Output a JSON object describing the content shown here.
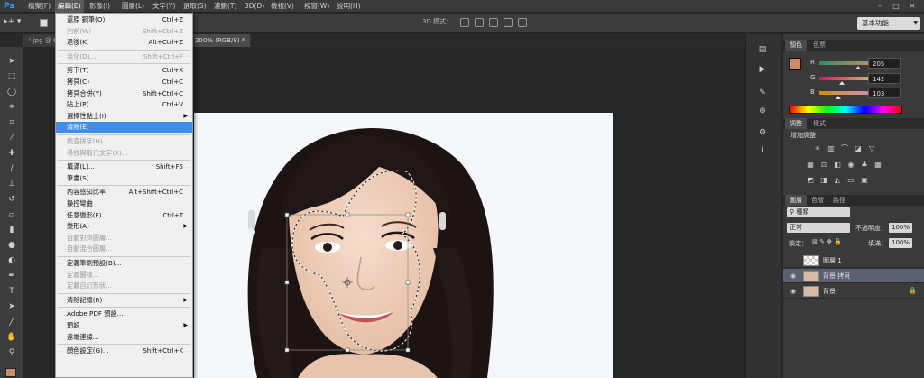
{
  "app": {
    "logo": "Ps"
  },
  "menubar": {
    "items": [
      {
        "label": "檔案(F)"
      },
      {
        "label": "編輯(E)"
      },
      {
        "label": "影像(I)"
      },
      {
        "label": "圖層(L)"
      },
      {
        "label": "文字(Y)"
      },
      {
        "label": "選取(S)"
      },
      {
        "label": "濾鏡(T)"
      },
      {
        "label": "3D(D)"
      },
      {
        "label": "檢視(V)"
      },
      {
        "label": "視窗(W)"
      },
      {
        "label": "說明(H)"
      }
    ],
    "window_controls": [
      "–",
      "□",
      "✕"
    ]
  },
  "options": {
    "mode_3d_label": "3D 模式：",
    "workspace": "基本功能"
  },
  "tabs": [
    {
      "label": "ᵋ.jpg @ 6"
    },
    {
      "label": "ᵋ @ 200% (RGB/8) *"
    }
  ],
  "edit_menu": {
    "items": [
      {
        "label": "還原 鋼筆(O)",
        "shortcut": "Ctrl+Z",
        "disabled": false
      },
      {
        "label": "向前(W)",
        "shortcut": "Shift+Ctrl+Z",
        "disabled": true
      },
      {
        "label": "退後(K)",
        "shortcut": "Alt+Ctrl+Z",
        "disabled": false
      },
      {
        "sep": true
      },
      {
        "label": "淡化(D)...",
        "shortcut": "Shift+Ctrl+F",
        "disabled": true
      },
      {
        "sep": true
      },
      {
        "label": "剪下(T)",
        "shortcut": "Ctrl+X",
        "disabled": false
      },
      {
        "label": "拷貝(C)",
        "shortcut": "Ctrl+C",
        "disabled": false
      },
      {
        "label": "拷貝合併(Y)",
        "shortcut": "Shift+Ctrl+C",
        "disabled": false
      },
      {
        "label": "貼上(P)",
        "shortcut": "Ctrl+V",
        "disabled": false
      },
      {
        "label": "選擇性貼上(I)",
        "shortcut": "",
        "submenu": true,
        "disabled": false
      },
      {
        "label": "清除(E)",
        "shortcut": "",
        "disabled": false,
        "highlight": true
      },
      {
        "sep": true
      },
      {
        "label": "檢查拼字(H)...",
        "shortcut": "",
        "disabled": true
      },
      {
        "label": "尋找與取代文字(X)...",
        "shortcut": "",
        "disabled": true
      },
      {
        "sep": true
      },
      {
        "label": "填滿(L)...",
        "shortcut": "Shift+F5",
        "disabled": false
      },
      {
        "label": "筆畫(S)...",
        "shortcut": "",
        "disabled": false
      },
      {
        "sep": true
      },
      {
        "label": "內容感知比率",
        "shortcut": "Alt+Shift+Ctrl+C",
        "disabled": false
      },
      {
        "label": "操控彎曲",
        "shortcut": "",
        "disabled": false
      },
      {
        "label": "任意變形(F)",
        "shortcut": "Ctrl+T",
        "disabled": false
      },
      {
        "label": "變形(A)",
        "shortcut": "",
        "submenu": true,
        "disabled": false
      },
      {
        "label": "自動對齊圖層...",
        "shortcut": "",
        "disabled": true
      },
      {
        "label": "自動混合圖層...",
        "shortcut": "",
        "disabled": true
      },
      {
        "sep": true
      },
      {
        "label": "定義筆刷預設(B)...",
        "shortcut": "",
        "disabled": false
      },
      {
        "label": "定義圖樣...",
        "shortcut": "",
        "disabled": true
      },
      {
        "label": "定義自訂形狀...",
        "shortcut": "",
        "disabled": true
      },
      {
        "sep": true
      },
      {
        "label": "清除記憶(R)",
        "shortcut": "",
        "submenu": true,
        "disabled": false
      },
      {
        "sep": true
      },
      {
        "label": "Adobe PDF 預設...",
        "shortcut": "",
        "disabled": false
      },
      {
        "label": "預設",
        "shortcut": "",
        "submenu": true,
        "disabled": false
      },
      {
        "label": "遠端連線...",
        "shortcut": "",
        "disabled": false
      },
      {
        "sep": true
      },
      {
        "label": "顏色設定(G)...",
        "shortcut": "Shift+Ctrl+K",
        "disabled": false
      }
    ]
  },
  "color_panel": {
    "tabs": [
      "顏色",
      "色票"
    ],
    "swatch_color": "#cd8e67",
    "channels": [
      {
        "label": "R",
        "value": "205"
      },
      {
        "label": "G",
        "value": "142"
      },
      {
        "label": "B",
        "value": "103"
      }
    ]
  },
  "adjust_panel": {
    "tabs": [
      "調整",
      "樣式"
    ],
    "title": "增加調整"
  },
  "layers_panel": {
    "tabs": [
      "圖層",
      "色版",
      "路徑"
    ],
    "kind": "種類",
    "blend_mode": "正常",
    "opacity_label": "不透明度：",
    "opacity_value": "100%",
    "lock_label": "鎖定：",
    "fill_label": "填滿：",
    "fill_value": "100%",
    "layers": [
      {
        "name": "圖層 1",
        "selected": false
      },
      {
        "name": "背景 拷貝",
        "selected": true
      },
      {
        "name": "背景",
        "selected": false,
        "locked": true
      }
    ]
  },
  "tools": [
    "move",
    "marquee",
    "lasso",
    "magic-wand",
    "crop",
    "eyedropper",
    "healing",
    "brush",
    "stamp",
    "history-brush",
    "eraser",
    "gradient",
    "blur",
    "dodge",
    "pen",
    "type",
    "path-select",
    "shape",
    "hand",
    "zoom"
  ],
  "colors": {
    "accent": "#3d8ee5",
    "foreground": "#cd8e67"
  }
}
